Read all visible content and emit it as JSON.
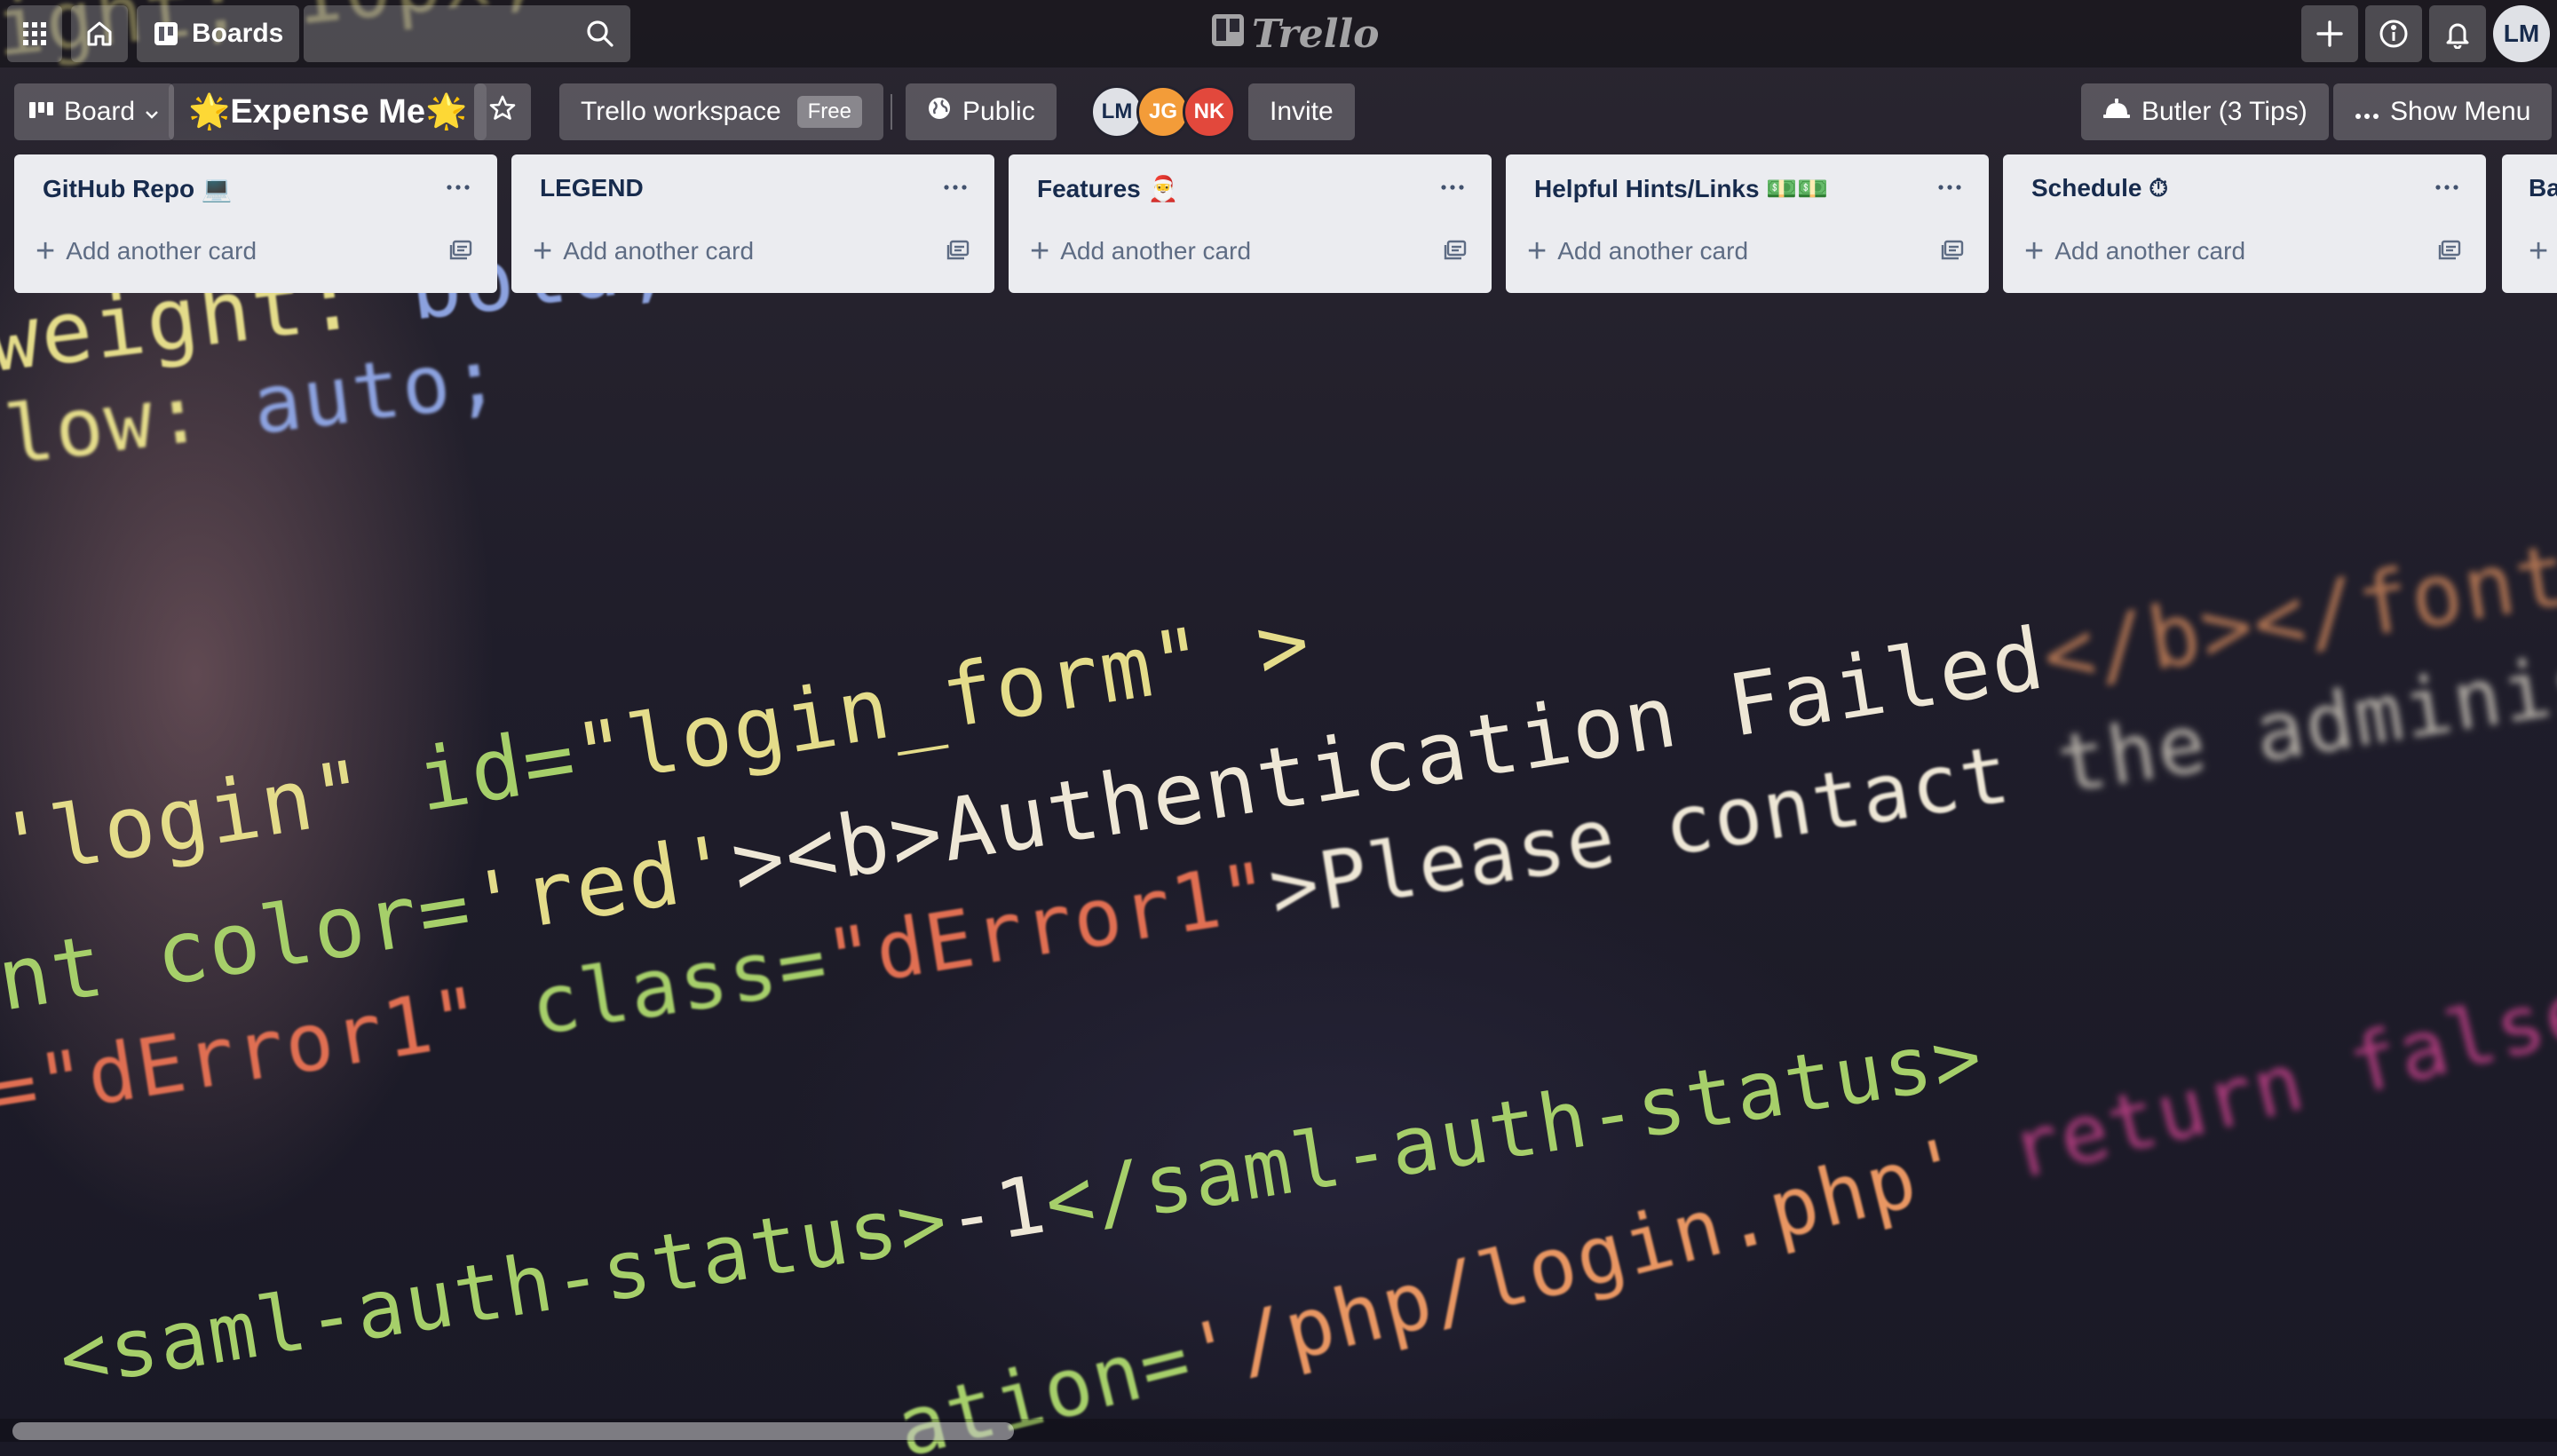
{
  "header": {
    "boards_label": "Boards",
    "search": {
      "value": "",
      "placeholder": ""
    },
    "logo_text": "Trello",
    "user_initials": "LM"
  },
  "board": {
    "view_label": "Board",
    "title": "🌟Expense Me🌟",
    "workspace_label": "Trello workspace",
    "workspace_badge": "Free",
    "visibility_label": "Public",
    "members": [
      {
        "initials": "LM",
        "color": "#dfe1e6",
        "text_color": "#172b4d"
      },
      {
        "initials": "JG",
        "color": "#f39c39"
      },
      {
        "initials": "NK",
        "color": "#e2483c"
      }
    ],
    "invite_label": "Invite",
    "butler_label": "Butler (3 Tips)",
    "show_menu_label": "Show Menu"
  },
  "lists": [
    {
      "title": "GitHub Repo 💻",
      "add_card": "Add another card"
    },
    {
      "title": "LEGEND",
      "add_card": "Add another card"
    },
    {
      "title": "Features 🎅",
      "add_card": "Add another card"
    },
    {
      "title": "Helpful Hints/Links 💵💵",
      "add_card": "Add another card"
    },
    {
      "title": "Schedule ⏱",
      "add_card": "Add another card"
    },
    {
      "title": "Ba"
    }
  ],
  "colors": {
    "list_bg": "#ebecf0",
    "list_title": "#172b4d",
    "muted_text": "#5e6c84"
  }
}
